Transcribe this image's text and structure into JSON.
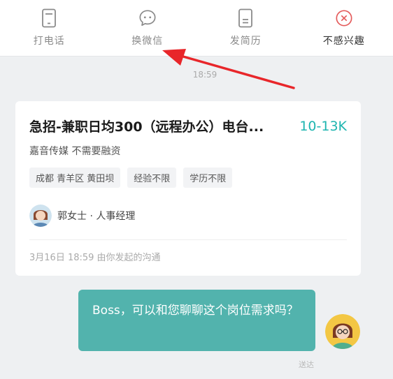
{
  "actions": [
    {
      "label": "打电话",
      "icon": "phone-icon"
    },
    {
      "label": "换微信",
      "icon": "chat-bubble-icon"
    },
    {
      "label": "发简历",
      "icon": "resume-icon"
    },
    {
      "label": "不感兴趣",
      "icon": "close-circle-icon"
    }
  ],
  "colors": {
    "accent": "#1fb5b0",
    "bubble": "#52b3ad",
    "danger": "#e45a5a",
    "arrow": "#e8262a"
  },
  "chat": {
    "time": "18:59",
    "job": {
      "title": "急招-兼职日均300（远程办公）电台...",
      "salary": "10-13K",
      "company": "嘉音传媒 不需要融资",
      "tags": [
        "成都 青羊区 黄田坝",
        "经验不限",
        "学历不限"
      ],
      "recruiter": "郭女士 · 人事经理",
      "footer": "3月16日 18:59 由你发起的沟通"
    },
    "message": {
      "text": "Boss，可以和您聊聊这个岗位需求吗？",
      "status": "送达"
    }
  }
}
